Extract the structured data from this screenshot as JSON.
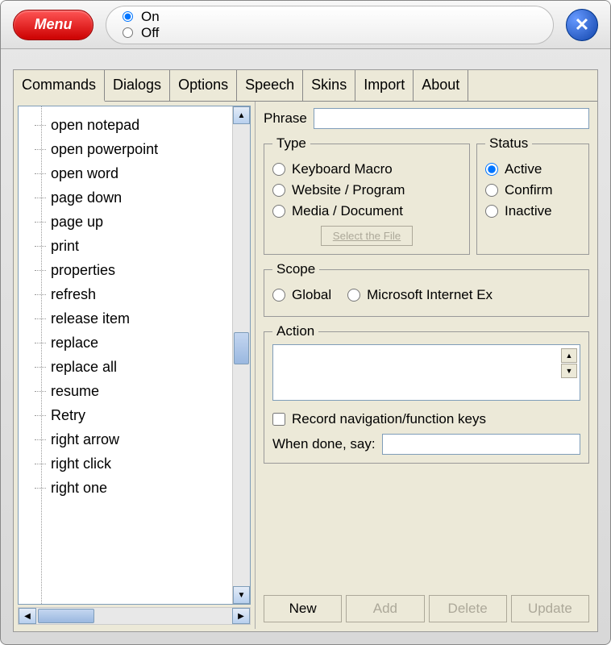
{
  "titlebar": {
    "menu_label": "Menu",
    "radio_on": "On",
    "radio_off": "Off",
    "close_glyph": "✕"
  },
  "tabs": [
    {
      "label": "Commands",
      "active": true
    },
    {
      "label": "Dialogs"
    },
    {
      "label": "Options"
    },
    {
      "label": "Speech"
    },
    {
      "label": "Skins"
    },
    {
      "label": "Import"
    },
    {
      "label": "About"
    }
  ],
  "commands_list": [
    "open notepad",
    "open powerpoint",
    "open word",
    "page down",
    "page up",
    "print",
    "properties",
    "refresh",
    "release item",
    "replace",
    "replace all",
    "resume",
    "Retry",
    "right arrow",
    "right click",
    "right one"
  ],
  "form": {
    "phrase_label": "Phrase",
    "phrase_value": "",
    "type_legend": "Type",
    "type_options": {
      "keyboard": "Keyboard Macro",
      "website": "Website / Program",
      "media": "Media / Document"
    },
    "select_file_label": "Select the File",
    "status_legend": "Status",
    "status_options": {
      "active": "Active",
      "confirm": "Confirm",
      "inactive": "Inactive"
    },
    "scope_legend": "Scope",
    "scope_global": "Global",
    "scope_ie": "Microsoft Internet Ex",
    "action_legend": "Action",
    "action_value": "",
    "record_nav_label": "Record navigation/function keys",
    "when_done_label": "When done, say:",
    "when_done_value": ""
  },
  "buttons": {
    "new": "New",
    "add": "Add",
    "delete": "Delete",
    "update": "Update"
  }
}
